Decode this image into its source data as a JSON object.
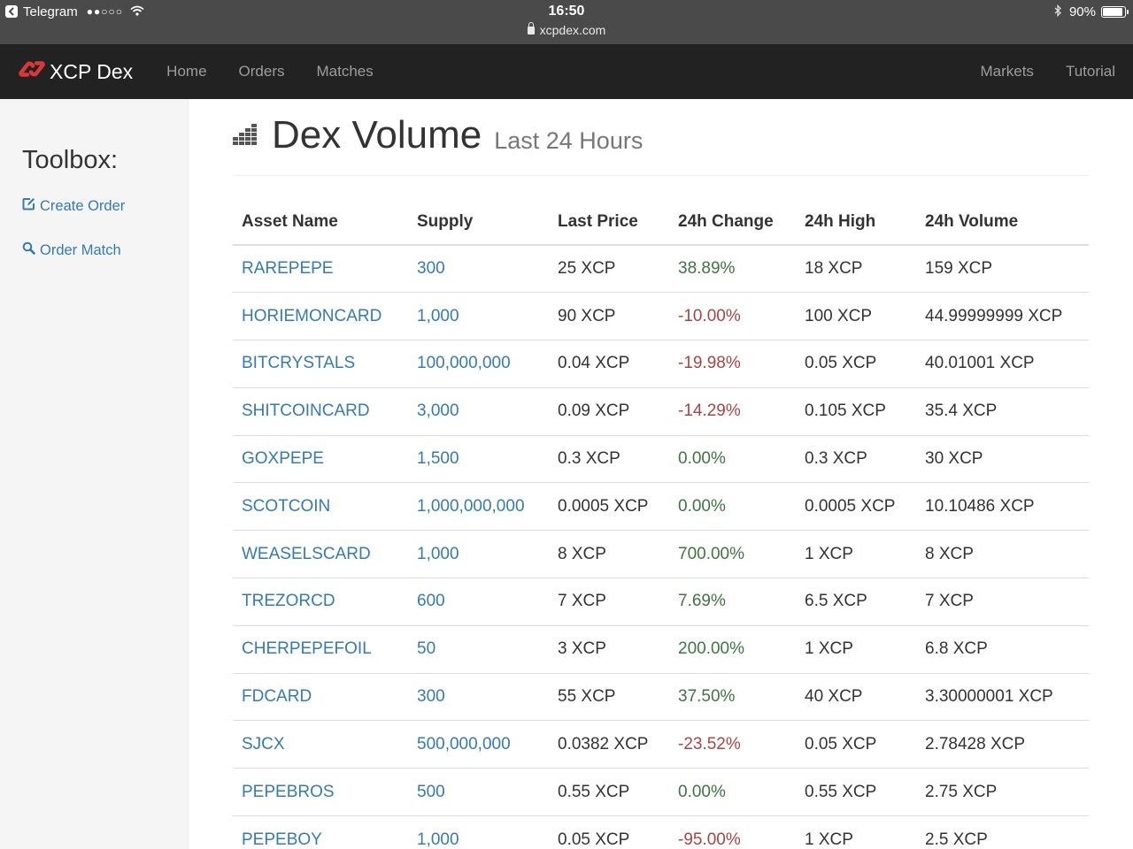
{
  "status": {
    "app": "Telegram",
    "signal": "●●○○○",
    "time": "16:50",
    "url": "xcpdex.com",
    "battery": "90%",
    "battery_level": 0.9
  },
  "nav": {
    "brand": "XCP Dex",
    "links": [
      "Home",
      "Orders",
      "Matches"
    ],
    "right_links": [
      "Markets",
      "Tutorial"
    ]
  },
  "sidebar": {
    "title": "Toolbox:",
    "create_order": "Create Order",
    "order_match": "Order Match"
  },
  "header": {
    "title": "Dex Volume",
    "subtitle": "Last 24 Hours"
  },
  "table": {
    "columns": [
      "Asset Name",
      "Supply",
      "Last Price",
      "24h Change",
      "24h High",
      "24h Volume"
    ],
    "rows": [
      {
        "asset": "RAREPEPE",
        "supply": "300",
        "last": "25 XCP",
        "change": "38.89%",
        "dir": "pos",
        "high": "18 XCP",
        "volume": "159 XCP"
      },
      {
        "asset": "HORIEMONCARD",
        "supply": "1,000",
        "last": "90 XCP",
        "change": "-10.00%",
        "dir": "neg",
        "high": "100 XCP",
        "volume": "44.99999999 XCP"
      },
      {
        "asset": "BITCRYSTALS",
        "supply": "100,000,000",
        "last": "0.04 XCP",
        "change": "-19.98%",
        "dir": "neg",
        "high": "0.05 XCP",
        "volume": "40.01001 XCP"
      },
      {
        "asset": "SHITCOINCARD",
        "supply": "3,000",
        "last": "0.09 XCP",
        "change": "-14.29%",
        "dir": "neg",
        "high": "0.105 XCP",
        "volume": "35.4 XCP"
      },
      {
        "asset": "GOXPEPE",
        "supply": "1,500",
        "last": "0.3 XCP",
        "change": "0.00%",
        "dir": "pos",
        "high": "0.3 XCP",
        "volume": "30 XCP"
      },
      {
        "asset": "SCOTCOIN",
        "supply": "1,000,000,000",
        "last": "0.0005 XCP",
        "change": "0.00%",
        "dir": "pos",
        "high": "0.0005 XCP",
        "volume": "10.10486 XCP"
      },
      {
        "asset": "WEASELSCARD",
        "supply": "1,000",
        "last": "8 XCP",
        "change": "700.00%",
        "dir": "pos",
        "high": "1 XCP",
        "volume": "8 XCP"
      },
      {
        "asset": "TREZORCD",
        "supply": "600",
        "last": "7 XCP",
        "change": "7.69%",
        "dir": "pos",
        "high": "6.5 XCP",
        "volume": "7 XCP"
      },
      {
        "asset": "CHERPEPEFOIL",
        "supply": "50",
        "last": "3 XCP",
        "change": "200.00%",
        "dir": "pos",
        "high": "1 XCP",
        "volume": "6.8 XCP"
      },
      {
        "asset": "FDCARD",
        "supply": "300",
        "last": "55 XCP",
        "change": "37.50%",
        "dir": "pos",
        "high": "40 XCP",
        "volume": "3.30000001 XCP"
      },
      {
        "asset": "SJCX",
        "supply": "500,000,000",
        "last": "0.0382 XCP",
        "change": "-23.52%",
        "dir": "neg",
        "high": "0.05 XCP",
        "volume": "2.78428 XCP"
      },
      {
        "asset": "PEPEBROS",
        "supply": "500",
        "last": "0.55 XCP",
        "change": "0.00%",
        "dir": "pos",
        "high": "0.55 XCP",
        "volume": "2.75 XCP"
      },
      {
        "asset": "PEPEBOY",
        "supply": "1,000",
        "last": "0.05 XCP",
        "change": "-95.00%",
        "dir": "neg",
        "high": "1 XCP",
        "volume": "2.5 XCP"
      }
    ]
  },
  "colors": {
    "link": "#337ab7",
    "positive": "#3c763d",
    "negative": "#a94442",
    "navbar": "#222222",
    "brand_logo": "#d9383a"
  }
}
